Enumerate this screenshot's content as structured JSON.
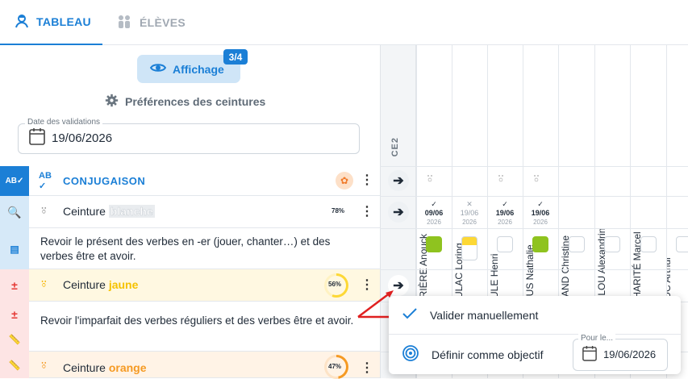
{
  "tabs": [
    {
      "label": "TABLEAU"
    },
    {
      "label": "ÉLÈVES"
    }
  ],
  "display_button": {
    "label": "Affichage",
    "badge": "3/4"
  },
  "preferences": {
    "label": "Préférences des ceintures"
  },
  "validation_date": {
    "label": "Date des validations",
    "value": "19/06/2026"
  },
  "class_label": "CE2",
  "students": [
    "BARRIÈRE Anouck",
    "BEAULAC Loring",
    "BEAULE Henri",
    "CAMUS Nathalie",
    "DURAND Christine",
    "GAILLOU Alexandrin",
    "LACHARITÉ Marcel",
    "LEDUC Arthur"
  ],
  "section": {
    "title": "CONJUGAISON"
  },
  "rows": {
    "blanche": {
      "prefix": "Ceinture",
      "color_word": "blanche",
      "percent": "78%"
    },
    "desc1": "Revoir le présent des verbes en -er (jouer, chanter…) et des verbes être et avoir.",
    "jaune": {
      "prefix": "Ceinture",
      "color_word": "jaune",
      "percent": "56%"
    },
    "desc2": "Revoir l'imparfait des verbes réguliers et des verbes être et avoir.",
    "orange": {
      "prefix": "Ceinture",
      "color_word": "orange",
      "percent": "47%"
    }
  },
  "validations": [
    {
      "mark": "✓",
      "date": "09/06",
      "year": "2026"
    },
    {
      "mark": "✕",
      "date": "19/06",
      "year": "2026"
    },
    {
      "mark": "✓",
      "date": "19/06",
      "year": "2026"
    },
    {
      "mark": "✓",
      "date": "19/06",
      "year": "2026"
    }
  ],
  "menu": {
    "validate": "Valider manuellement",
    "objective": "Définir comme objectif",
    "pour_label": "Pour le...",
    "pour_value": "19/06/2026"
  },
  "colors": {
    "accent": "#1b7fd6",
    "green": "#8fc31f",
    "yellow": "#fdd835",
    "orange": "#f5a623",
    "red": "#e53935"
  }
}
